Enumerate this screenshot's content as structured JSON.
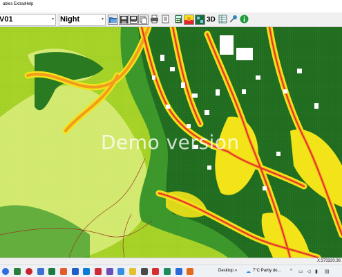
{
  "menu": {
    "items": [
      "ables",
      "Extras",
      "Help"
    ]
  },
  "toolbar": {
    "layer_combo": "V01",
    "period_combo": "Night",
    "btn_3d": "3D"
  },
  "map": {
    "watermark": "Demo version"
  },
  "status": {
    "coords": "X:373320.36"
  },
  "taskbar": {
    "desktop_label": "Desktop",
    "desktop_arrow": "»",
    "weather": "7°C Partly do..."
  },
  "colors": {
    "light_green": "#a9d52a",
    "pale_green": "#d8ec78",
    "mid_green": "#3e9a2c",
    "dark_green": "#1f6a1f",
    "yellow": "#f3e419",
    "orange": "#f29b1e",
    "red": "#e3252a",
    "building": "#ffffff",
    "info_green": "#1e9a3a"
  }
}
